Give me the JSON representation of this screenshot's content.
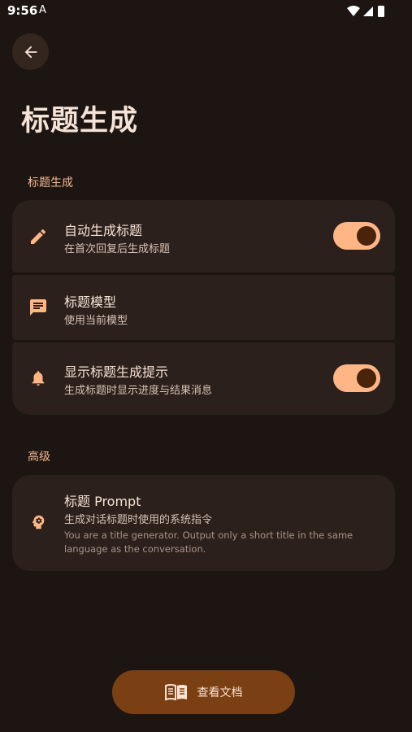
{
  "status_bar": {
    "time": "9:56",
    "indicator": "A",
    "icons": [
      "wifi-icon",
      "signal-icon",
      "battery-icon"
    ]
  },
  "header": {
    "back_icon": "arrow-left-icon",
    "title": "标题生成"
  },
  "sections": {
    "title_generation": {
      "label": "标题生成",
      "items": [
        {
          "icon": "pencil-icon",
          "title": "自动生成标题",
          "subtitle": "在首次回复后生成标题",
          "toggle_on": true
        },
        {
          "icon": "chat-icon",
          "title": "标题模型",
          "subtitle": "使用当前模型"
        },
        {
          "icon": "bell-icon",
          "title": "显示标题生成提示",
          "subtitle": "生成标题时显示进度与结果消息",
          "toggle_on": true
        }
      ]
    },
    "advanced": {
      "label": "高级",
      "items": [
        {
          "icon": "brain-gear-icon",
          "title": "标题 Prompt",
          "subtitle": "生成对话标题时使用的系统指令",
          "description": "You are a title generator. Output only a short title in the same language as the conversation."
        }
      ]
    }
  },
  "footer": {
    "docs_icon": "book-icon",
    "docs_label": "查看文档"
  },
  "colors": {
    "background": "#1d1512",
    "card": "#2b201b",
    "accent": "#ffb687",
    "accent_dark": "#4a240a",
    "button": "#7a3f12"
  }
}
